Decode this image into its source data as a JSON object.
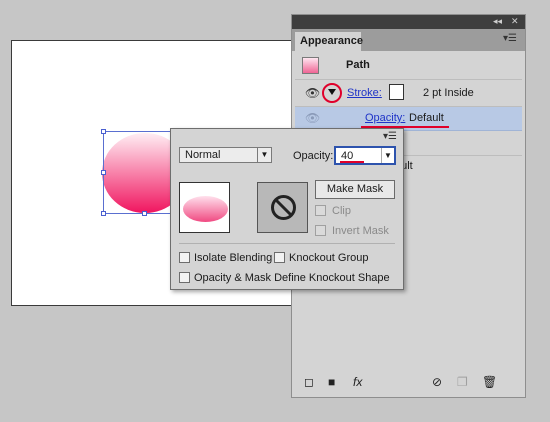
{
  "panel": {
    "title": "Appearance",
    "topbar_icons": [
      "collapse-icon",
      "close-icon"
    ],
    "menu_icon": "panel-menu-icon",
    "rows": {
      "path_label": "Path",
      "stroke_label": "Stroke:",
      "stroke_value": "2 pt  Inside",
      "opacity_label": "Opacity:",
      "opacity_value": "Default",
      "partial_value": "ault"
    },
    "bottom_icons": [
      "add-new-stroke-icon",
      "add-new-fill-icon",
      "fx-icon",
      "clear-appearance-icon",
      "duplicate-item-icon",
      "delete-icon"
    ],
    "fx_label": "fx",
    "colors": {
      "selected_row": "#b8c9e5",
      "highlight": "#e0002a",
      "link": "#1f34c8"
    }
  },
  "popup": {
    "blend_mode": "Normal",
    "opacity_label": "Opacity:",
    "opacity_value": "40",
    "make_mask_label": "Make Mask",
    "clip_label": "Clip",
    "invert_mask_label": "Invert Mask",
    "isolate_blending_label": "Isolate Blending",
    "knockout_group_label": "Knockout Group",
    "opacity_mask_label": "Opacity & Mask Define Knockout Shape"
  },
  "canvas": {
    "gradient_colors": [
      "#ffeef4",
      "#f0155f"
    ]
  }
}
